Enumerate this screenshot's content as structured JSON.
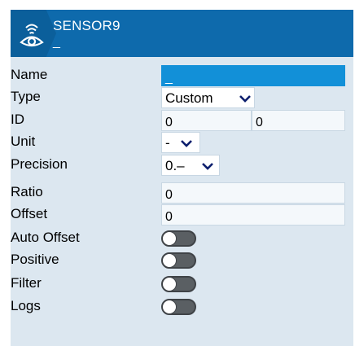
{
  "header": {
    "icon": "sensor-eye-icon",
    "title": "SENSOR9",
    "subtitle": "_"
  },
  "form": {
    "name": {
      "label": "Name",
      "value": "_"
    },
    "type": {
      "label": "Type",
      "value": "Custom"
    },
    "id": {
      "label": "ID",
      "value1": "0",
      "value2": "0"
    },
    "unit": {
      "label": "Unit",
      "value": "-"
    },
    "precision": {
      "label": "Precision",
      "value": "0.–"
    },
    "ratio": {
      "label": "Ratio",
      "value": "0"
    },
    "offset": {
      "label": "Offset",
      "value": "0"
    },
    "auto_offset": {
      "label": "Auto Offset",
      "enabled": false
    },
    "positive": {
      "label": "Positive",
      "enabled": false
    },
    "filter": {
      "label": "Filter",
      "enabled": false
    },
    "logs": {
      "label": "Logs",
      "enabled": false
    }
  },
  "colors": {
    "header_bg": "#0e6aac",
    "panel_bg": "#dce7f0",
    "highlight": "#1290d8",
    "toggle_off": "#5a5f63"
  }
}
